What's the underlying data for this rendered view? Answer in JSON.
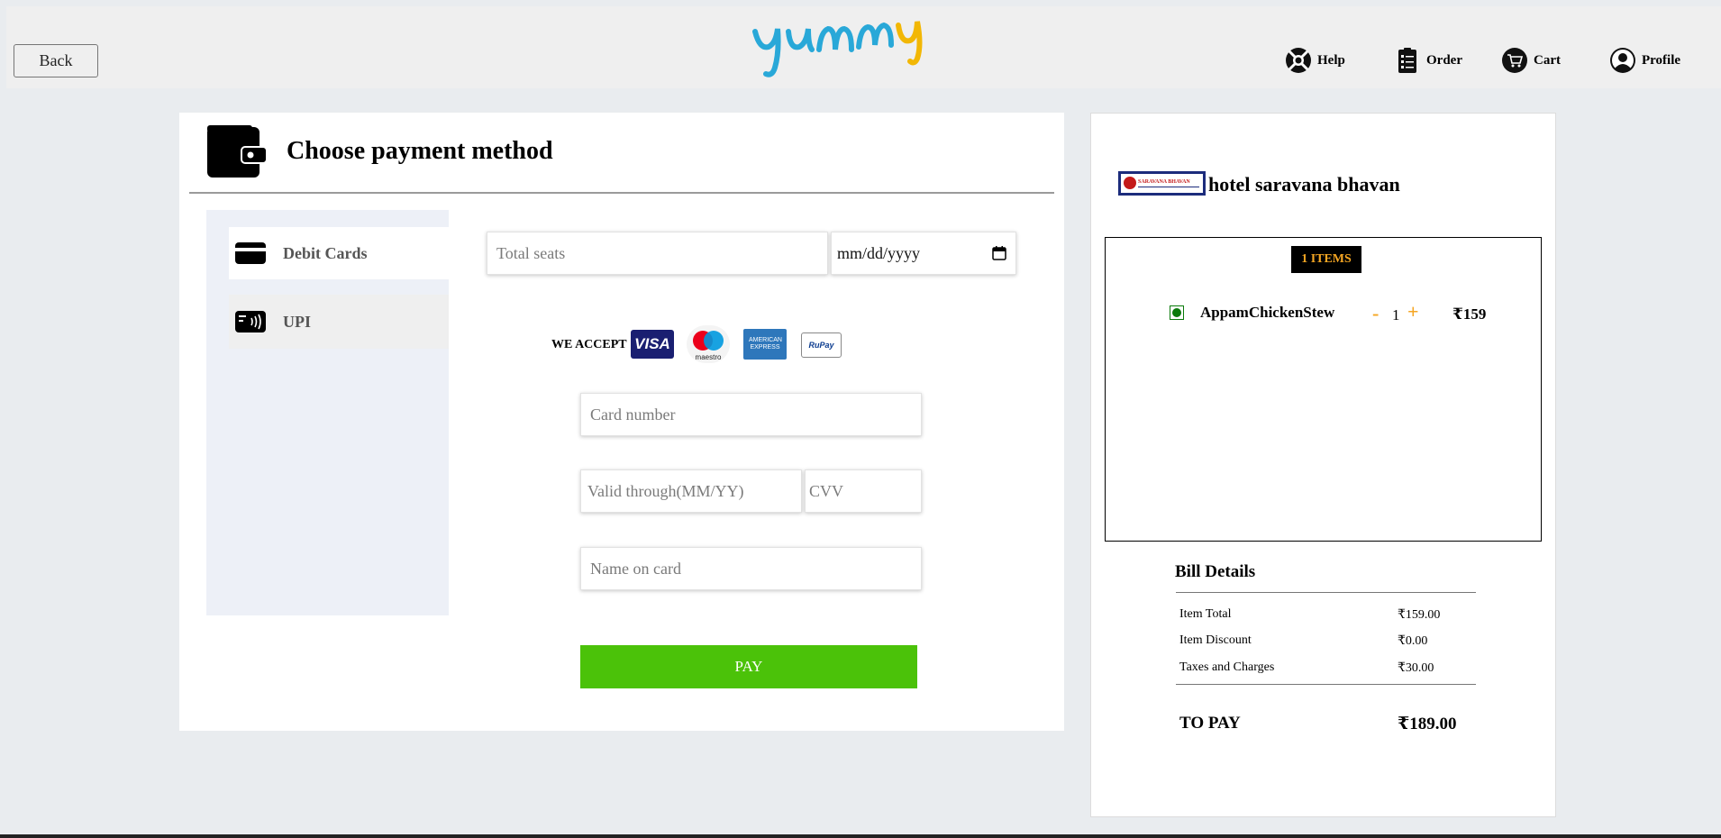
{
  "header": {
    "back_label": "Back",
    "logo_text": "yummy",
    "nav": [
      {
        "label": "Help",
        "icon": "help-lifebuoy-icon"
      },
      {
        "label": "Order",
        "icon": "clipboard-list-icon"
      },
      {
        "label": "Cart",
        "icon": "cart-icon"
      },
      {
        "label": "Profile",
        "icon": "user-circle-icon"
      }
    ]
  },
  "payment": {
    "title": "Choose payment method",
    "tabs": [
      {
        "label": "Debit Cards",
        "icon": "credit-card-icon",
        "active": true
      },
      {
        "label": "UPI",
        "icon": "contactless-card-icon",
        "active": false
      }
    ],
    "total_seats_placeholder": "Total seats",
    "date_placeholder": "mm/dd/yyyy",
    "we_accept_label": "WE ACCEPT",
    "card_brands": [
      "VISA",
      "maestro",
      "AMERICAN EXPRESS",
      "RuPay"
    ],
    "card_number_placeholder": "Card number",
    "valid_through_placeholder": "Valid through(MM/YY)",
    "cvv_placeholder": "CVV",
    "name_on_card_placeholder": "Name on card",
    "pay_label": "PAY",
    "pay_color": "#4bc209"
  },
  "cart": {
    "hotel_logo_text": "SARAVANA BHAVAN",
    "hotel_name": "hotel saravana bhavan",
    "items_badge": "1 ITEMS",
    "items": [
      {
        "name": "AppamChickenStew",
        "minus": "-",
        "qty": "1",
        "plus": "+",
        "price": "₹159",
        "veg": true
      }
    ],
    "bill": {
      "title": "Bill Details",
      "rows": [
        {
          "label": "Item Total",
          "value": "₹159.00"
        },
        {
          "label": "Item Discount",
          "value": "₹0.00"
        },
        {
          "label": "Taxes and Charges",
          "value": "₹30.00"
        }
      ],
      "to_pay_label": "TO PAY",
      "to_pay_value": "₹189.00"
    }
  },
  "colors": {
    "accent_orange": "#f5a623",
    "logo_blue": "#29a8d8",
    "logo_yellow": "#f2b705",
    "veg_green": "#0a7a0a"
  }
}
